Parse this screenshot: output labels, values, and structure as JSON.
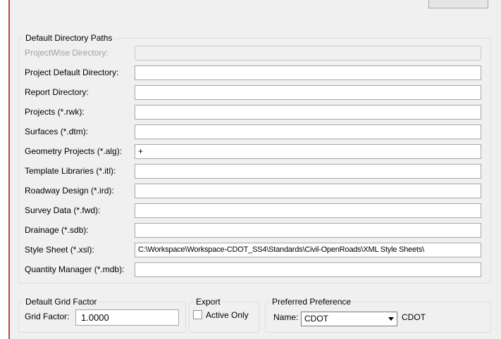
{
  "dialog": {
    "directory_paths": {
      "title": "Default Directory Paths",
      "rows": [
        {
          "label": "ProjectWise Directory:",
          "value": ""
        },
        {
          "label": "Project Default Directory:",
          "value": ""
        },
        {
          "label": "Report Directory:",
          "value": ""
        },
        {
          "label": "Projects (*.rwk):",
          "value": ""
        },
        {
          "label": "Surfaces (*.dtm):",
          "value": ""
        },
        {
          "label": "Geometry Projects (*.alg):",
          "value": "+"
        },
        {
          "label": "Template Libraries (*.itl):",
          "value": ""
        },
        {
          "label": "Roadway Design (*.ird):",
          "value": ""
        },
        {
          "label": "Survey Data (*.fwd):",
          "value": ""
        },
        {
          "label": "Drainage (*.sdb):",
          "value": ""
        },
        {
          "label": "Style Sheet (*.xsl):",
          "value": "C:\\Workspace\\Workspace-CDOT_SS4\\Standards\\Civil-OpenRoads\\XML Style Sheets\\"
        },
        {
          "label": "Quantity Manager (*.mdb):",
          "value": ""
        }
      ]
    },
    "grid_factor": {
      "title": "Default Grid Factor",
      "label": "Grid Factor:",
      "value": "1.0000"
    },
    "export": {
      "title": "Export",
      "checkbox_label": "Active Only",
      "checked": false
    },
    "preference": {
      "title": "Preferred Preference",
      "name_label": "Name:",
      "selected": "CDOT",
      "current": "CDOT"
    }
  }
}
